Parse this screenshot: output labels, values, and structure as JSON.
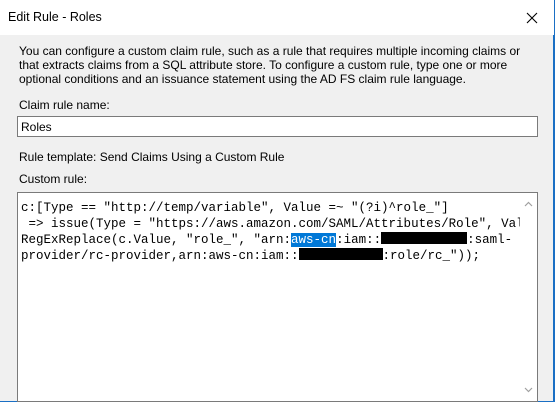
{
  "window": {
    "title": "Edit Rule - Roles"
  },
  "description": "You can configure a custom claim rule, such as a rule that requires multiple incoming claims or that extracts claims from a SQL attribute store. To configure a custom rule, type one or more optional conditions and an issuance statement using the AD FS claim rule language.",
  "claim_rule_name": {
    "label": "Claim rule name:",
    "value": "Roles"
  },
  "rule_template": "Rule template: Send Claims Using a Custom Rule",
  "custom_rule": {
    "label": "Custom rule:",
    "line1": "c:[Type == \"http://temp/variable\", Value =~ \"(?i)^role_\"]",
    "line2": " => issue(Type = \"https://aws.amazon.com/SAML/Attributes/Role\", Value =",
    "line3_prefix": "RegExReplace(c.Value, \"role_\", \"arn:",
    "line3_selected": "aws-cn",
    "line3_mid": ":iam::",
    "line3_suffix": ":saml-",
    "line4_prefix": "provider/rc-provider,arn:aws-cn:iam::",
    "line4_suffix": ":role/rc_\"));"
  }
}
